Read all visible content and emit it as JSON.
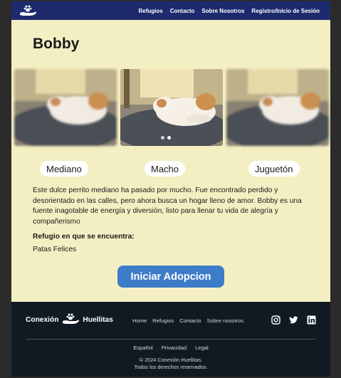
{
  "navbar": {
    "logo_icon": "hand-paw-icon",
    "links": [
      "Refugios",
      "Contacto",
      "Sobre Nosotros",
      "Registro/Inicio de Sesión"
    ]
  },
  "pet": {
    "name": "Bobby",
    "traits": [
      "Mediano",
      "Macho",
      "Juguetón"
    ],
    "description": "Este dulce perrito mediano ha pasado por mucho. Fue encontrado perdido y desorientado en las calles, pero ahora busca un hogar lleno de amor. Bobby es una fuente inagotable de energía y diversión, listo para llenar tu vida de alegría y compañerismo",
    "shelter_label": "Refugio en que se encuentra:",
    "shelter": "Patas Felices"
  },
  "carousel": {
    "slides": 3,
    "active_dot": 1,
    "dots": 2
  },
  "adopt_button": "Iniciar Adopcion",
  "footer": {
    "brand_left": "Conexión",
    "brand_right": "Huellitas",
    "links": [
      "Home",
      "Refugios",
      "Contacto",
      "Sobre nosotros"
    ],
    "socials": [
      "instagram-icon",
      "twitter-icon",
      "linkedin-icon"
    ],
    "legal": [
      "Español",
      "Privacidad",
      "Legal"
    ],
    "copyright_line1": "© 2024 Conexión Huellitas.",
    "copyright_line2": "Todos los derechos reservados."
  },
  "colors": {
    "navbar": "#1d2a6e",
    "page_bg": "#f4efc3",
    "button": "#3d7cc9",
    "footer": "#111a22"
  }
}
